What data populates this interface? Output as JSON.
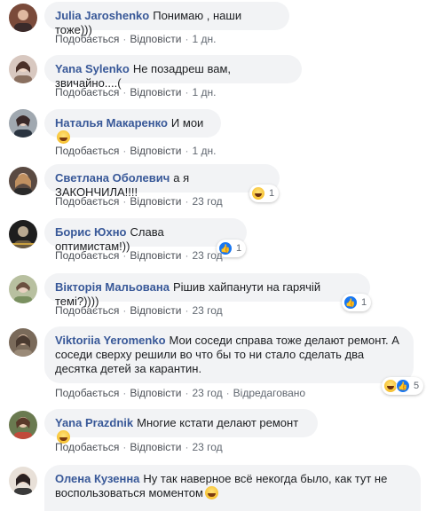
{
  "actions": {
    "like": "Подобається",
    "reply": "Відповісти",
    "edited": "Відредаговано"
  },
  "comments": [
    {
      "author": "Julia Jaroshenko",
      "text": "Понимаю , наши тоже)))",
      "time": "1 дн.",
      "avatar_color": "#7a4a3a"
    },
    {
      "author": "Yana Sylenko",
      "text": "Не позадреш вам, звичайно....(",
      "time": "1 дн.",
      "avatar_color": "#b89a8a"
    },
    {
      "author": "Наталья Макаренко",
      "text": "И мои",
      "time": "1 дн.",
      "avatar_color": "#6e7a86",
      "emoji": "grinning-emoji"
    },
    {
      "author": "Светлана Оболевич",
      "text": "а я ЗАКОНЧИЛА!!!!",
      "time": "23 год",
      "avatar_color": "#8a6a5a",
      "reactions": [
        "haha"
      ],
      "reaction_count": "1"
    },
    {
      "author": "Борис Юхно",
      "text": "Слава оптимистам!))",
      "time": "23 год",
      "avatar_color": "#3a3a3a",
      "reactions": [
        "like"
      ],
      "reaction_count": "1"
    },
    {
      "author": "Вікторія Мальована",
      "text": "Рішив хайпанути на гарячій темі?))))",
      "time": "23 год",
      "avatar_color": "#9aa07a",
      "reactions": [
        "like"
      ],
      "reaction_count": "1"
    },
    {
      "author": "Viktoriia Yeromenko",
      "text": "Мои соседи справа тоже делают ремонт. А соседи сверху решили во что бы то ни стало сделать два десятка детей за карантин.",
      "time": "23 год",
      "avatar_color": "#8a7a6a",
      "reactions": [
        "haha",
        "like"
      ],
      "reaction_count": "5",
      "edited": true
    },
    {
      "author": "Yana Prazdnik",
      "text": "Многие кстати делают ремонт",
      "time": "23 год",
      "avatar_color": "#5a6a4a",
      "emoji": "rofl-emoji"
    },
    {
      "author": "Олена Кузенна",
      "text": "Ну так наверное всё некогда было, как тут не воспользоваться моментом",
      "time": "",
      "avatar_color": "#c8b8a8",
      "emoji": "grinning-emoji"
    }
  ]
}
